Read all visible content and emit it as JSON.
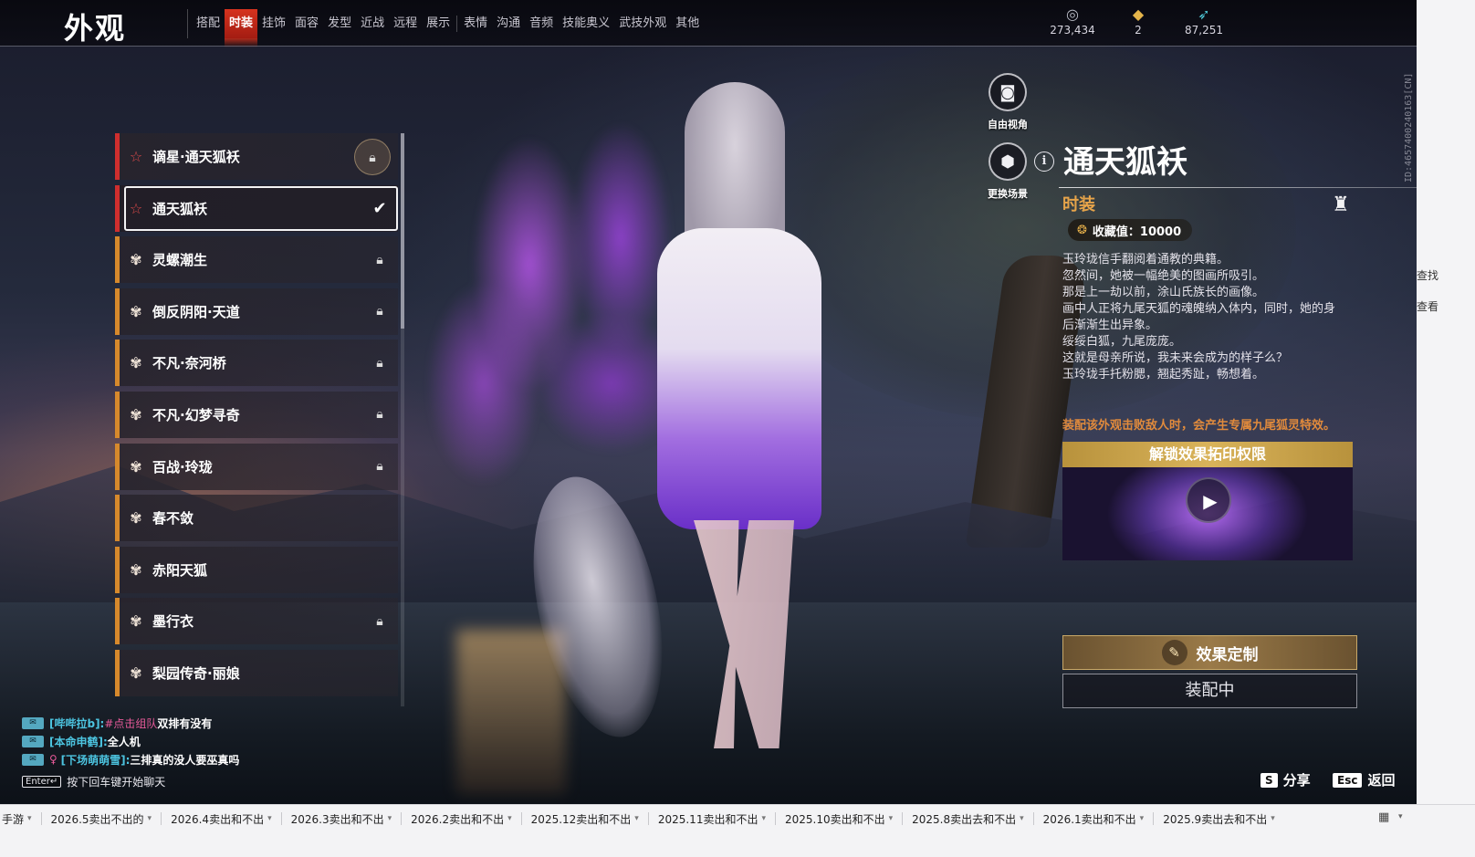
{
  "header": {
    "title": "外观",
    "tabs": [
      {
        "label": "搭配",
        "active": false
      },
      {
        "label": "时装",
        "active": true
      },
      {
        "label": "挂饰",
        "active": false
      },
      {
        "label": "面容",
        "active": false
      },
      {
        "label": "发型",
        "active": false
      },
      {
        "label": "近战",
        "active": false
      },
      {
        "label": "远程",
        "active": false
      },
      {
        "label": "展示",
        "active": false
      },
      {
        "label": "表情",
        "active": false
      },
      {
        "label": "沟通",
        "active": false
      },
      {
        "label": "音频",
        "active": false
      },
      {
        "label": "技能奥义",
        "active": false
      },
      {
        "label": "武技外观",
        "active": false
      },
      {
        "label": "其他",
        "active": false
      }
    ],
    "currencies": [
      {
        "icon": "silver-coin-icon",
        "value": "273,434"
      },
      {
        "icon": "gold-ticket-icon",
        "value": "2"
      },
      {
        "icon": "feather-icon",
        "value": "87,251"
      }
    ]
  },
  "outfit_list": [
    {
      "name": "谪星·通天狐袄",
      "rarity": "red",
      "state": "locked-special"
    },
    {
      "name": "通天狐袄",
      "rarity": "red",
      "state": "selected-equipped"
    },
    {
      "name": "灵螺潮生",
      "rarity": "orange",
      "state": "locked"
    },
    {
      "name": "倒反阴阳·天道",
      "rarity": "orange",
      "state": "locked"
    },
    {
      "name": "不凡·奈河桥",
      "rarity": "orange",
      "state": "locked"
    },
    {
      "name": "不凡·幻梦寻奇",
      "rarity": "orange",
      "state": "locked"
    },
    {
      "name": "百战·玲珑",
      "rarity": "orange",
      "state": "locked"
    },
    {
      "name": "春不敛",
      "rarity": "orange",
      "state": "unlocked"
    },
    {
      "name": "赤阳天狐",
      "rarity": "orange",
      "state": "unlocked"
    },
    {
      "name": "墨行衣",
      "rarity": "orange",
      "state": "locked"
    },
    {
      "name": "梨园传奇·丽娘",
      "rarity": "orange",
      "state": "unlocked"
    }
  ],
  "camera": {
    "free_view_label": "自由视角",
    "change_scene_label": "更换场景"
  },
  "detail": {
    "title": "通天狐袄",
    "category": "时装",
    "collect_label": "收藏值：10000",
    "description": [
      "玉玲珑信手翻阅着通教的典籍。",
      "忽然间，她被一幅绝美的图画所吸引。",
      "那是上一劫以前，涂山氏族长的画像。",
      "画中人正将九尾天狐的魂魄纳入体内，同时，她的身",
      "后渐渐生出异象。",
      "绥绥白狐，九尾庞庞。",
      "这就是母亲所说，我未来会成为的样子么？",
      "玉玲珑手托粉腮，翘起秀趾，畅想着。"
    ],
    "effect_note": "装配该外观击败敌人时，会产生专属九尾狐灵特效。",
    "unlock_label": "解锁效果拓印权限",
    "custom_label": "效果定制",
    "equipped_label": "装配中"
  },
  "vertical_id": "ID:4657400240163[CN]",
  "chat": {
    "lines": [
      {
        "sender": "[哔哔拉b]:",
        "tag": "#点击组队",
        "message": " 双排有没有"
      },
      {
        "sender": "[本命申鹤]:",
        "tag": "",
        "message": "全人机"
      },
      {
        "sender": "[下场萌萌雪]:",
        "tag": "",
        "message": "三排真的没人要巫真吗"
      }
    ],
    "enter_key": "Enter↵",
    "hint": "按下回车键开始聊天"
  },
  "hints": {
    "share_key": "S",
    "share_label": "分享",
    "back_key": "Esc",
    "back_label": "返回"
  },
  "edge_texts": [
    "查找",
    "查看"
  ],
  "tabstrip": {
    "lead": "手游",
    "tabs": [
      "2026.5卖出不出的",
      "2026.4卖出和不出",
      "2026.3卖出和不出",
      "2026.2卖出和不出",
      "2025.12卖出和不出",
      "2025.11卖出和不出",
      "2025.10卖出和不出",
      "2025.8卖出去和不出",
      "2026.1卖出和不出",
      "2025.9卖出去和不出"
    ]
  },
  "colors": {
    "accent_red": "#d6331e",
    "gold": "#e6a44a",
    "effect_note": "#e08a3c",
    "rarity_red": "#cf2e2e",
    "rarity_orange": "#d6892c"
  }
}
